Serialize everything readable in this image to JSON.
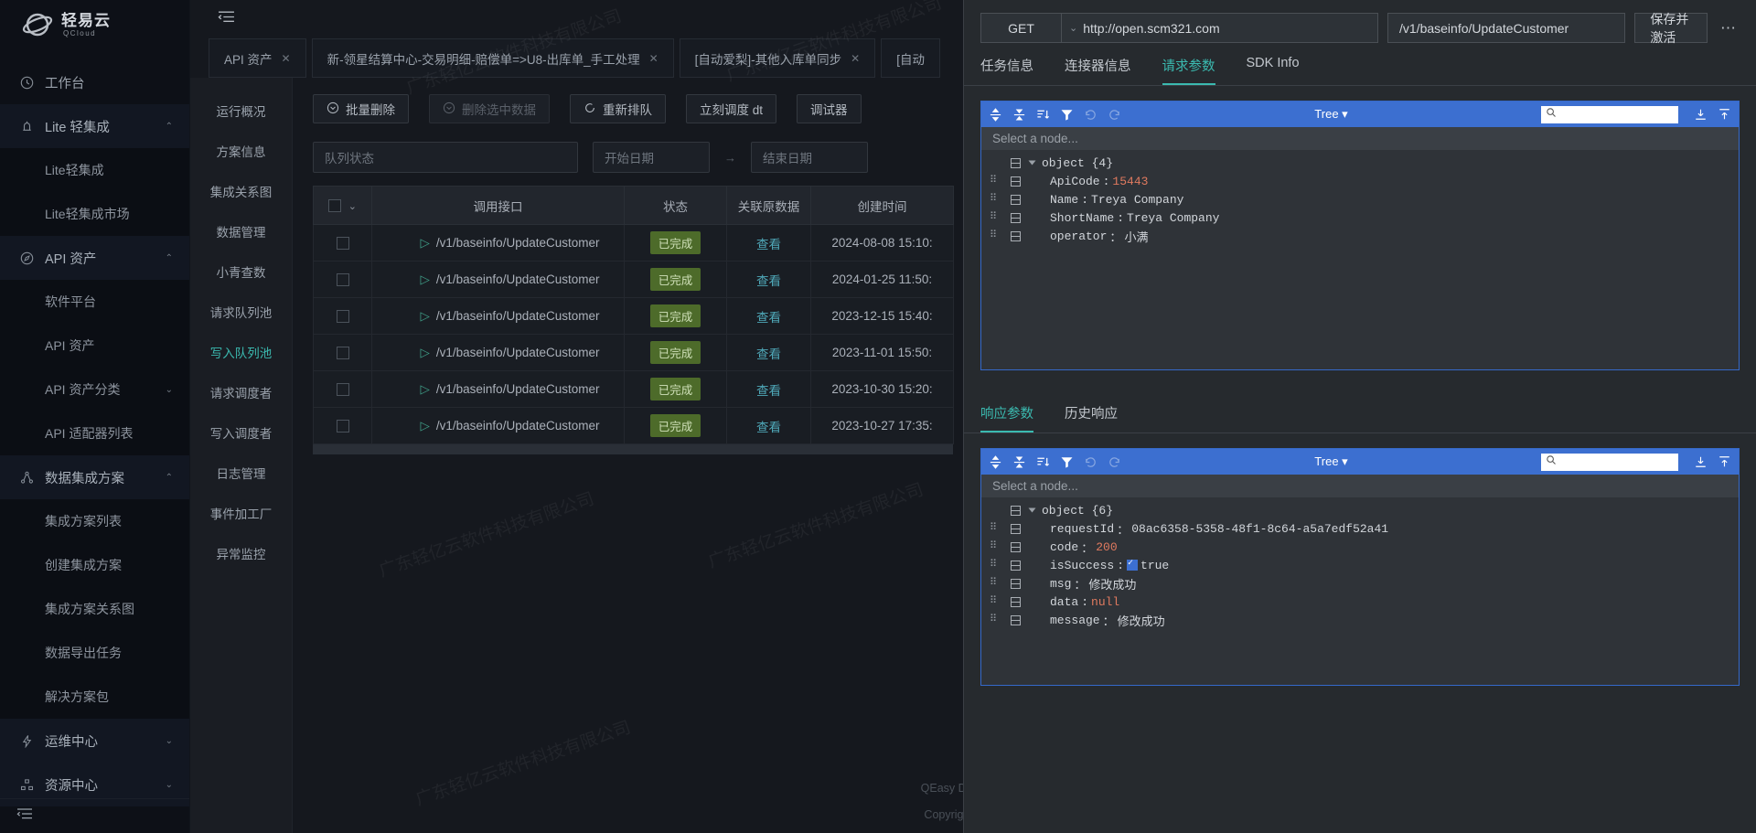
{
  "brand": {
    "cn": "轻易云",
    "en": "QCloud"
  },
  "sidebar": {
    "items": [
      {
        "label": "工作台",
        "icon": "clock-icon",
        "type": "top",
        "caret": ""
      },
      {
        "label": "Lite 轻集成",
        "icon": "bell-icon",
        "type": "top",
        "caret": "⌃"
      },
      {
        "label": "Lite轻集成",
        "type": "sub",
        "caret": ""
      },
      {
        "label": "Lite轻集成市场",
        "type": "sub",
        "caret": ""
      },
      {
        "label": "API 资产",
        "icon": "compass-icon",
        "type": "top",
        "caret": "⌃"
      },
      {
        "label": "软件平台",
        "type": "sub",
        "caret": ""
      },
      {
        "label": "API 资产",
        "type": "sub",
        "caret": ""
      },
      {
        "label": "API 资产分类",
        "type": "sub",
        "caret": "⌄"
      },
      {
        "label": "API 适配器列表",
        "type": "sub",
        "caret": ""
      },
      {
        "label": "数据集成方案",
        "icon": "sitemap-icon",
        "type": "top",
        "caret": "⌃"
      },
      {
        "label": "集成方案列表",
        "type": "sub",
        "caret": ""
      },
      {
        "label": "创建集成方案",
        "type": "sub",
        "caret": ""
      },
      {
        "label": "集成方案关系图",
        "type": "sub",
        "caret": ""
      },
      {
        "label": "数据导出任务",
        "type": "sub",
        "caret": ""
      },
      {
        "label": "解决方案包",
        "type": "sub",
        "caret": ""
      },
      {
        "label": "运维中心",
        "icon": "bolt-icon",
        "type": "top",
        "caret": "⌄"
      },
      {
        "label": "资源中心",
        "icon": "grid-icon",
        "type": "top",
        "caret": "⌄"
      }
    ]
  },
  "tabs": [
    {
      "label": "API 资产",
      "close": "✕"
    },
    {
      "label": "新-领星结算中心-交易明细-赔偿单=>U8-出库单_手工处理",
      "close": "✕"
    },
    {
      "label": "[自动爱梨]-其他入库单同步",
      "close": "✕"
    },
    {
      "label": "[自动",
      "close": ""
    }
  ],
  "subnav": {
    "items": [
      {
        "label": "运行概况",
        "active": false
      },
      {
        "label": "方案信息",
        "active": false
      },
      {
        "label": "集成关系图",
        "active": false
      },
      {
        "label": "数据管理",
        "active": false
      },
      {
        "label": "小青查数",
        "active": false
      },
      {
        "label": "请求队列池",
        "active": false
      },
      {
        "label": "写入队列池",
        "active": true
      },
      {
        "label": "请求调度者",
        "active": false
      },
      {
        "label": "写入调度者",
        "active": false
      },
      {
        "label": "日志管理",
        "active": false
      },
      {
        "label": "事件加工厂",
        "active": false
      },
      {
        "label": "异常监控",
        "active": false
      }
    ]
  },
  "toolbar": {
    "buttons": [
      {
        "label": "批量删除",
        "icon": "circle-down-icon",
        "disabled": false
      },
      {
        "label": "删除选中数据",
        "icon": "circle-down-icon",
        "disabled": true
      },
      {
        "label": "重新排队",
        "icon": "refresh-icon",
        "disabled": false
      },
      {
        "label": "立刻调度 dt",
        "icon": "",
        "disabled": false
      },
      {
        "label": "调试器",
        "icon": "",
        "disabled": false
      }
    ]
  },
  "filters": {
    "queue_status_placeholder": "队列状态",
    "start_date_placeholder": "开始日期",
    "range_sep": "→",
    "end_date_placeholder": "结束日期"
  },
  "table": {
    "headers": [
      "",
      "调用接口",
      "状态",
      "关联原数据",
      "创建时间"
    ],
    "rows": [
      {
        "api": "/v1/baseinfo/UpdateCustomer",
        "status": "已完成",
        "link": "查看",
        "created": "2024-08-08 15:10:"
      },
      {
        "api": "/v1/baseinfo/UpdateCustomer",
        "status": "已完成",
        "link": "查看",
        "created": "2024-01-25 11:50:"
      },
      {
        "api": "/v1/baseinfo/UpdateCustomer",
        "status": "已完成",
        "link": "查看",
        "created": "2023-12-15 15:40:"
      },
      {
        "api": "/v1/baseinfo/UpdateCustomer",
        "status": "已完成",
        "link": "查看",
        "created": "2023-11-01 15:50:"
      },
      {
        "api": "/v1/baseinfo/UpdateCustomer",
        "status": "已完成",
        "link": "查看",
        "created": "2023-10-30 15:20:"
      },
      {
        "api": "/v1/baseinfo/UpdateCustomer",
        "status": "已完成",
        "link": "查看",
        "created": "2023-10-27 17:35:"
      }
    ]
  },
  "footer": {
    "line1": "QEasy Development",
    "line2": "Copyright © 广东轻"
  },
  "watermark": "广东轻亿云软件科技有限公司",
  "drawer": {
    "method": "GET",
    "method_caret": "⌄",
    "host": "http://open.scm321.com",
    "path": "/v1/baseinfo/UpdateCustomer",
    "save_label": "保存并激活",
    "more_label": "⋯",
    "tabs": [
      {
        "label": "任务信息",
        "active": false
      },
      {
        "label": "连接器信息",
        "active": false
      },
      {
        "label": "请求参数",
        "active": true
      },
      {
        "label": "SDK Info",
        "active": false
      }
    ],
    "request_editor": {
      "mode_label": "Tree",
      "mode_caret": "▾",
      "select_placeholder": "Select a node...",
      "root": "object  {4}",
      "nodes": [
        {
          "key": "ApiCode",
          "value": "15443",
          "vtype": "num"
        },
        {
          "key": "Name",
          "value": "Treya Company",
          "vtype": "str"
        },
        {
          "key": "ShortName",
          "value": "Treya Company",
          "vtype": "str"
        },
        {
          "key": "operator",
          "value": "小满",
          "vtype": "str"
        }
      ]
    },
    "response_tabs": [
      {
        "label": "响应参数",
        "active": true
      },
      {
        "label": "历史响应",
        "active": false
      }
    ],
    "response_editor": {
      "mode_label": "Tree",
      "mode_caret": "▾",
      "select_placeholder": "Select a node...",
      "root": "object  {6}",
      "nodes": [
        {
          "key": "requestId",
          "value": "08ac6358-5358-48f1-8c64-a5a7edf52a41",
          "vtype": "str"
        },
        {
          "key": "code",
          "value": "200",
          "vtype": "num"
        },
        {
          "key": "isSuccess",
          "value": "true",
          "vtype": "bool"
        },
        {
          "key": "msg",
          "value": "修改成功",
          "vtype": "str"
        },
        {
          "key": "data",
          "value": "null",
          "vtype": "null"
        },
        {
          "key": "message",
          "value": "修改成功",
          "vtype": "str"
        }
      ]
    }
  },
  "colors": {
    "accent": "#3bbab0",
    "json_toolbar": "#3c6fd0",
    "status_badge": "#4d6b2a",
    "link": "#4fa8b8"
  }
}
